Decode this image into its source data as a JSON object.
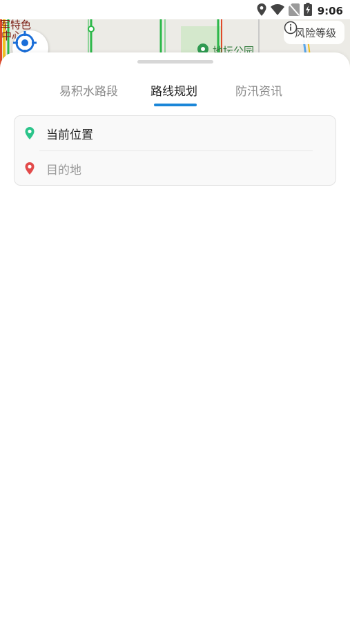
{
  "status_bar": {
    "time": "9:06",
    "icons": [
      "location-icon",
      "wifi-icon",
      "sim-off-icon",
      "battery-charging-icon"
    ]
  },
  "map": {
    "poi_label_line1": "军特色",
    "poi_label_line2": "中心",
    "park_label": "地坛公园",
    "locate_button_icon": "crosshair-icon",
    "risk_level_label": "风险等级",
    "risk_level_icon": "info-icon"
  },
  "tabs": [
    {
      "label": "易积水路段",
      "active": false
    },
    {
      "label": "路线规划",
      "active": true
    },
    {
      "label": "防汛资讯",
      "active": false
    }
  ],
  "route": {
    "start_label": "当前位置",
    "destination_placeholder": "目的地"
  },
  "colors": {
    "accent": "#1a86d8",
    "start_pin": "#2bc48a",
    "dest_pin": "#e24a4a"
  }
}
